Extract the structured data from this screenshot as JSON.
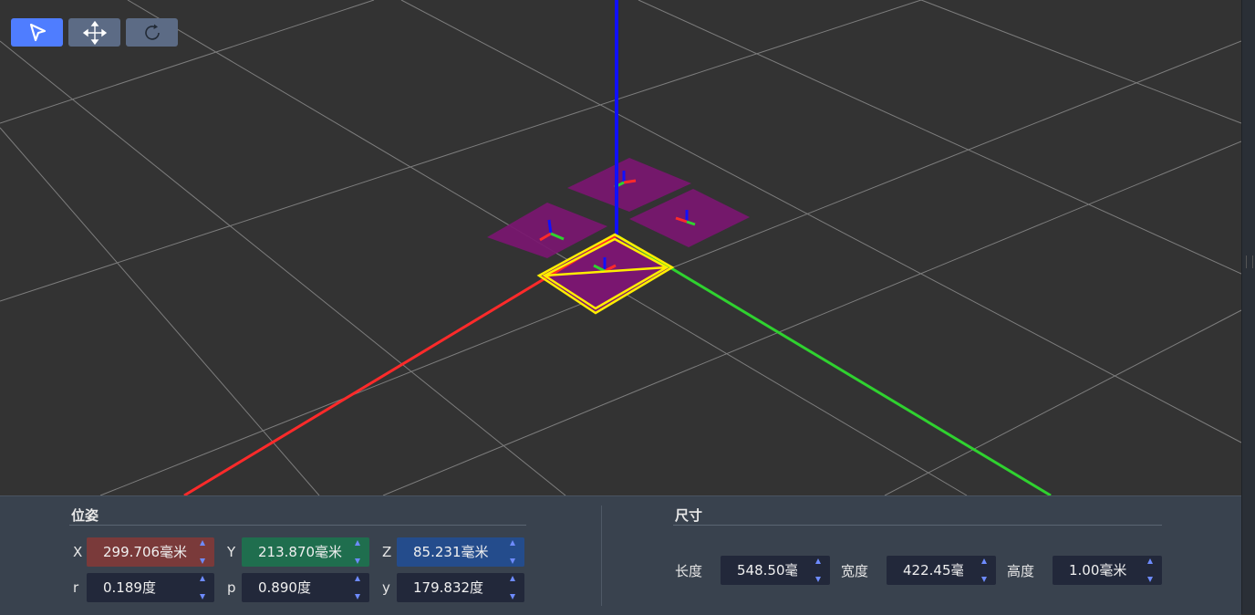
{
  "toolbar": {
    "tools": [
      {
        "id": "select",
        "icon": "cursor-arrow-icon",
        "active": true
      },
      {
        "id": "move",
        "icon": "move-arrows-icon",
        "active": false
      },
      {
        "id": "rotate",
        "icon": "rotate-icon",
        "active": false
      }
    ]
  },
  "colors": {
    "background": "#333333",
    "grid_line": "#8a8a8a",
    "axis_x": "#ff2a2a",
    "axis_y": "#2fd22f",
    "axis_z": "#1010ff",
    "plate_fill": "#7a1670",
    "selection": "#ffee00",
    "active_tool": "#4f7dff",
    "x_field": "#7a3a3a",
    "y_field": "#1f6e4e",
    "z_field": "#244c8c",
    "field_bg": "#22283a",
    "spin_arrow": "#6e8bff"
  },
  "pose": {
    "title": "位姿",
    "x_label": "X",
    "x_value": "299.706毫米",
    "y_label": "Y",
    "y_value": "213.870毫米",
    "z_label": "Z",
    "z_value": "85.231毫米",
    "r_label": "r",
    "r_value": "0.189度",
    "p_label": "p",
    "p_value": "0.890度",
    "yaw_label": "y",
    "yaw_value": "179.832度"
  },
  "size": {
    "title": "尺寸",
    "length_label": "长度",
    "length_value": "548.50毫米",
    "width_label": "宽度",
    "width_value": "422.45毫米",
    "height_label": "高度",
    "height_value": "1.00毫米"
  }
}
